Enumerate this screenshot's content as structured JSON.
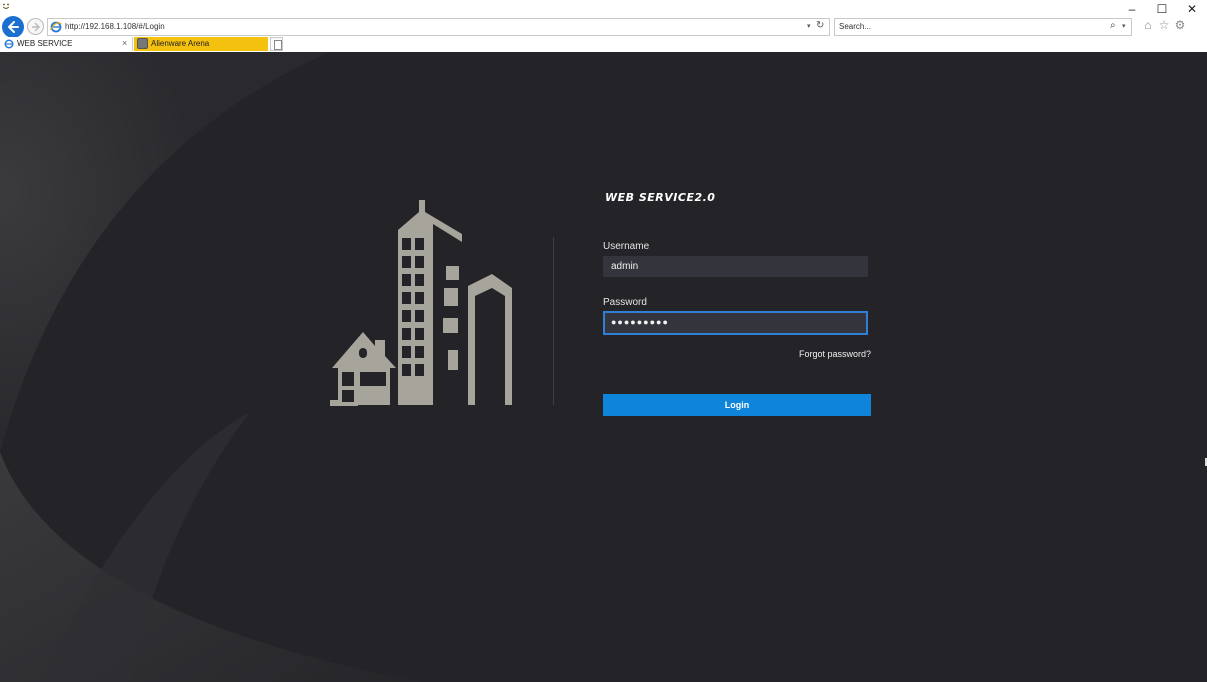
{
  "browser": {
    "window_controls": {
      "minimize": "–",
      "maximize": "☐",
      "close": "✕"
    },
    "address": "http://192.168.1.108/#/Login",
    "search_placeholder": "Search...",
    "tabs": [
      {
        "label": "WEB SERVICE",
        "active": true,
        "close": "×"
      },
      {
        "label": "Alienware Arena",
        "active": false,
        "color": "#f5c10f"
      }
    ],
    "icons": [
      "back-icon",
      "forward-icon",
      "ie-icon",
      "refresh-icon",
      "search-icon",
      "home-icon",
      "favorites-icon",
      "settings-icon",
      "feedback-smiley-icon"
    ]
  },
  "login": {
    "product_title": "WEB SERVICE2.0",
    "username_label": "Username",
    "username_value": "admin",
    "password_label": "Password",
    "password_value": "●●●●●●●●●",
    "forgot_link": "Forgot password?",
    "login_button": "Login"
  },
  "colors": {
    "background": "#232328",
    "field_bg": "#34353c",
    "focus_border": "#2f7fd6",
    "button": "#0e84db",
    "logo": "#a7a59b"
  }
}
